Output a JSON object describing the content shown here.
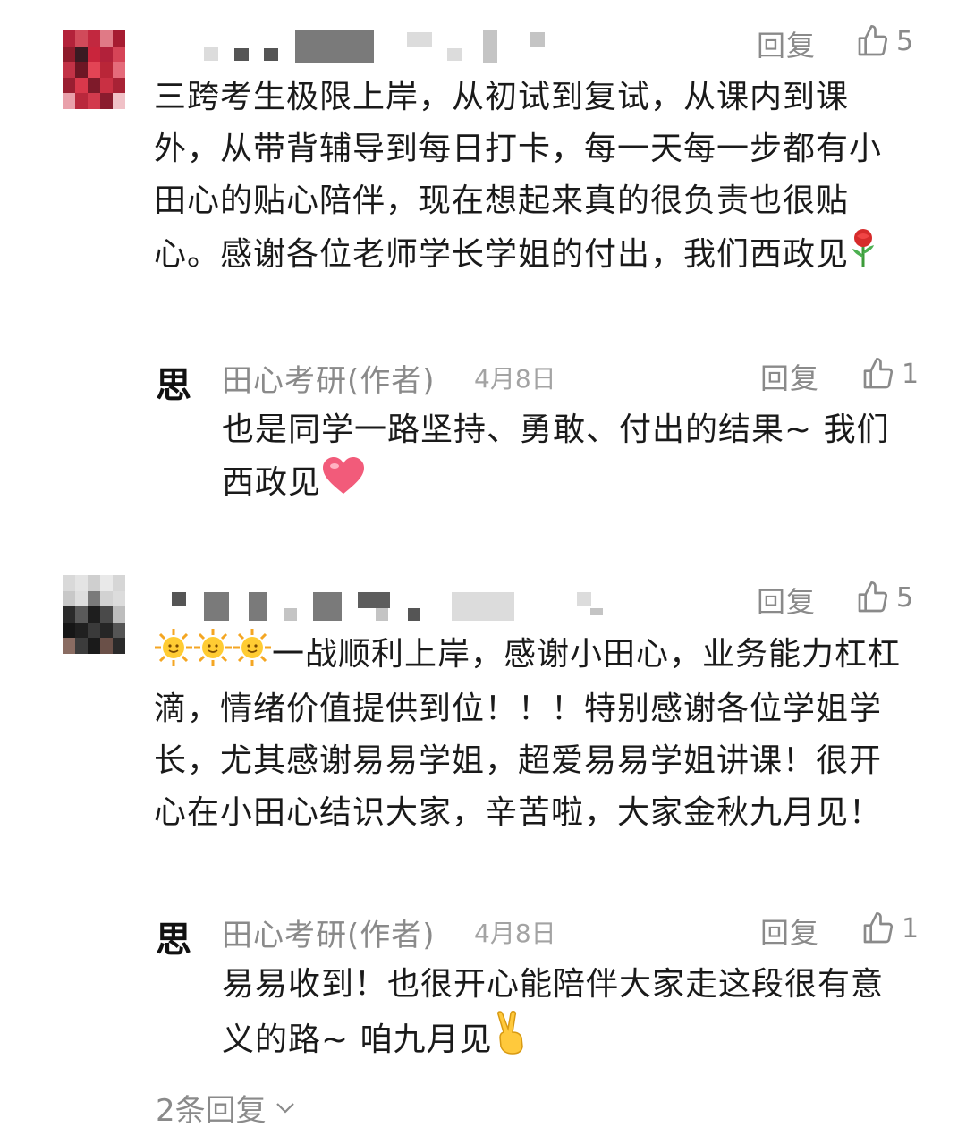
{
  "comments": [
    {
      "reply_label": "回复",
      "likes": "5",
      "text": "三跨考生极限上岸，从初试到复试，从课内到课外，从带背辅导到每日打卡，每一天每一步都有小田心的贴心陪伴，现在想起来真的很负责也很贴心。感谢各位老师学长学姐的付出，我们西政见",
      "text_emoji": "rose-icon",
      "author_reply": {
        "author": "田心考研(作者)",
        "date": "4月8日",
        "reply_label": "回复",
        "likes": "1",
        "text": "也是同学一路坚持、勇敢、付出的结果~ 我们西政见",
        "text_emoji": "heart-icon"
      }
    },
    {
      "reply_label": "回复",
      "likes": "5",
      "text": "一战顺利上岸，感谢小田心，业务能力杠杠滴，情绪价值提供到位！！！特别感谢各位学姐学长，尤其感谢易易学姐，超爱易易学姐讲课！很开心在小田心结识大家，辛苦啦，大家金秋九月见！",
      "lead_emoji": [
        "sun-face-icon",
        "sun-face-icon",
        "sun-face-icon"
      ],
      "author_reply": {
        "author": "田心考研(作者)",
        "date": "4月8日",
        "reply_label": "回复",
        "likes": "1",
        "text": "易易收到！也很开心能陪伴大家走这段很有意义的路~ 咱九月见",
        "text_emoji": "victory-hand-icon"
      }
    }
  ],
  "expand_replies": "2条回复",
  "colors": {
    "text": "#1a1a1a",
    "muted": "#8a8a8a",
    "date": "#a3a3a3"
  }
}
